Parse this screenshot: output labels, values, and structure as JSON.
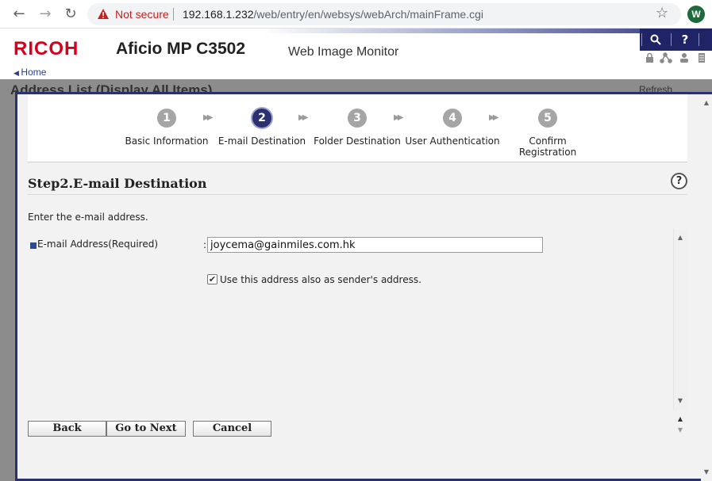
{
  "browser": {
    "back_icon": "arrow-left-icon",
    "forward_icon": "arrow-right-icon",
    "reload_icon": "reload-icon",
    "security_label": "Not secure",
    "url_host": "192.168.1.232",
    "url_path": "/web/entry/en/websys/webArch/mainFrame.cgi",
    "profile_initial": "W"
  },
  "header": {
    "brand": "RICOH",
    "model": "Aficio MP C3502",
    "app_name": "Web Image Monitor",
    "search_symbol": "🔍",
    "help_symbol": "?",
    "home_link": "Home",
    "brand_color": "#d6001c",
    "accent_color": "#2b3170"
  },
  "background_page": {
    "title": "Address List (Display All Items)",
    "refresh_label": "Refresh"
  },
  "wizard": {
    "steps": [
      {
        "number": "1",
        "label": "Basic Information",
        "active": false
      },
      {
        "number": "2",
        "label": "E-mail Destination",
        "active": true
      },
      {
        "number": "3",
        "label": "Folder Destination",
        "active": false
      },
      {
        "number": "4",
        "label": "User Authentication",
        "active": false
      },
      {
        "number": "5",
        "label_line1": "Confirm",
        "label_line2": "Registration",
        "active": false
      }
    ],
    "step_title": "Step2.E-mail Destination",
    "help_symbol": "?",
    "instruction": "Enter the e-mail address.",
    "email_field": {
      "label": "E-mail Address(Required)",
      "colon": ":",
      "value": "joycema@gainmiles.com.hk"
    },
    "sender_checkbox": {
      "checked": true,
      "label": "Use this address also as sender's address."
    },
    "buttons": {
      "back": "Back",
      "next": "Go to Next",
      "cancel": "Cancel"
    }
  }
}
